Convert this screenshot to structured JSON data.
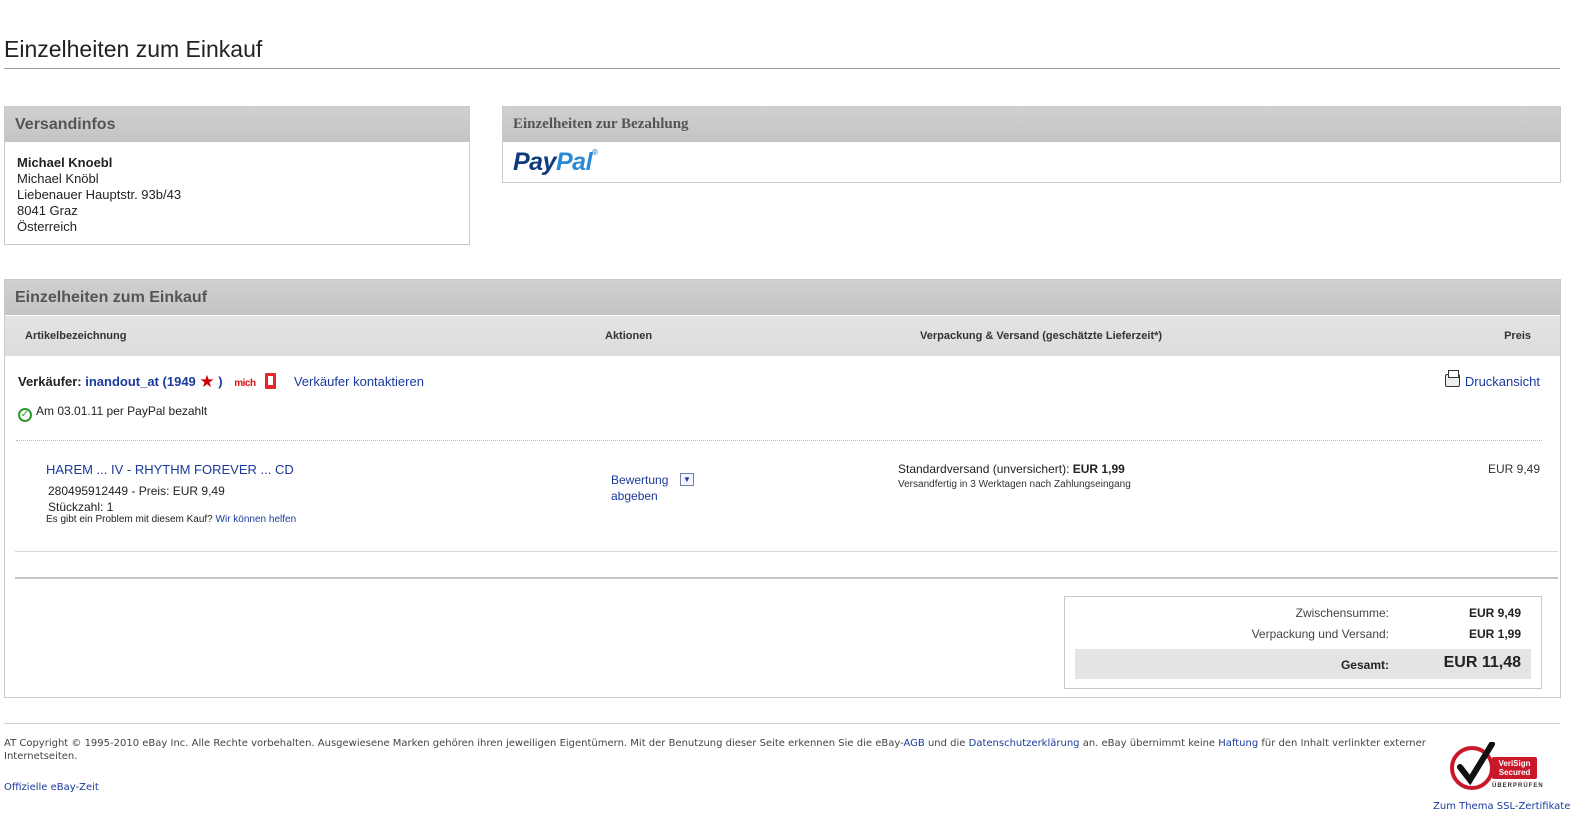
{
  "page": {
    "title": "Einzelheiten zum Einkauf"
  },
  "shipping": {
    "heading": "Versandinfos",
    "name_bold": "Michael Knoebl",
    "name": "Michael Knöbl",
    "street": "Liebenauer Hauptstr. 93b/43",
    "city": "8041 Graz",
    "country": "Österreich"
  },
  "payment": {
    "heading": "Einzelheiten zur Bezahlung",
    "logo_part1": "Pay",
    "logo_part2": "Pal",
    "logo_tm": "®"
  },
  "details": {
    "heading": "Einzelheiten zum Einkauf",
    "columns": {
      "item": "Artikelbezeichnung",
      "actions": "Aktionen",
      "shipping": "Verpackung & Versand (geschätzte Lieferzeit*)",
      "price": "Preis"
    },
    "seller": {
      "label": "Verkäufer:",
      "username": "inandout_at",
      "score_open": "(",
      "score": "1949",
      "score_close": ")",
      "me_badge": "mich",
      "contact": "Verkäufer kontaktieren"
    },
    "paid_status": "Am 03.01.11 per PayPal bezahlt",
    "print_label": "Druckansicht",
    "item": {
      "title": "HAREM ... IV - RHYTHM FOREVER ... CD",
      "number_price": "280495912449 - Preis: EUR 9,49",
      "quantity": "Stückzahl: 1",
      "problem_text": "Es gibt ein Problem mit diesem Kauf?",
      "help_link": "Wir können helfen",
      "feedback_line1": "Bewertung",
      "feedback_line2": "abgeben",
      "ship_method": "Standardversand (unversichert):",
      "ship_cost": "EUR 1,99",
      "ship_sub": "Versandfertig in 3 Werktagen nach Zahlungseingang",
      "price": "EUR 9,49"
    },
    "totals": {
      "subtotal_label": "Zwischensumme:",
      "subtotal_value": "EUR 9,49",
      "shipping_label": "Verpackung und Versand:",
      "shipping_value": "EUR 1,99",
      "total_label": "Gesamt:",
      "total_value": "EUR 11,48"
    }
  },
  "footer": {
    "copyright_a": "AT Copyright © 1995-2010 eBay Inc. Alle Rechte vorbehalten. Ausgewiesene Marken gehören ihren jeweiligen Eigentümern. Mit der Benutzung dieser Seite erkennen Sie die eBay-",
    "agb": "AGB",
    "copyright_b": " und die ",
    "privacy": "Datenschutzerklärung",
    "copyright_c": " an. eBay übernimmt keine ",
    "liability": "Haftung",
    "copyright_d": " für den Inhalt verlinkter externer Internetseiten.",
    "ebay_time": "Offizielle eBay-Zeit",
    "verisign_line1": "VeriSign",
    "verisign_line2": "Secured",
    "verisign_sub": "ÜBERPRÜFEN",
    "ssl_link": "Zum Thema SSL-Zertifikate"
  }
}
